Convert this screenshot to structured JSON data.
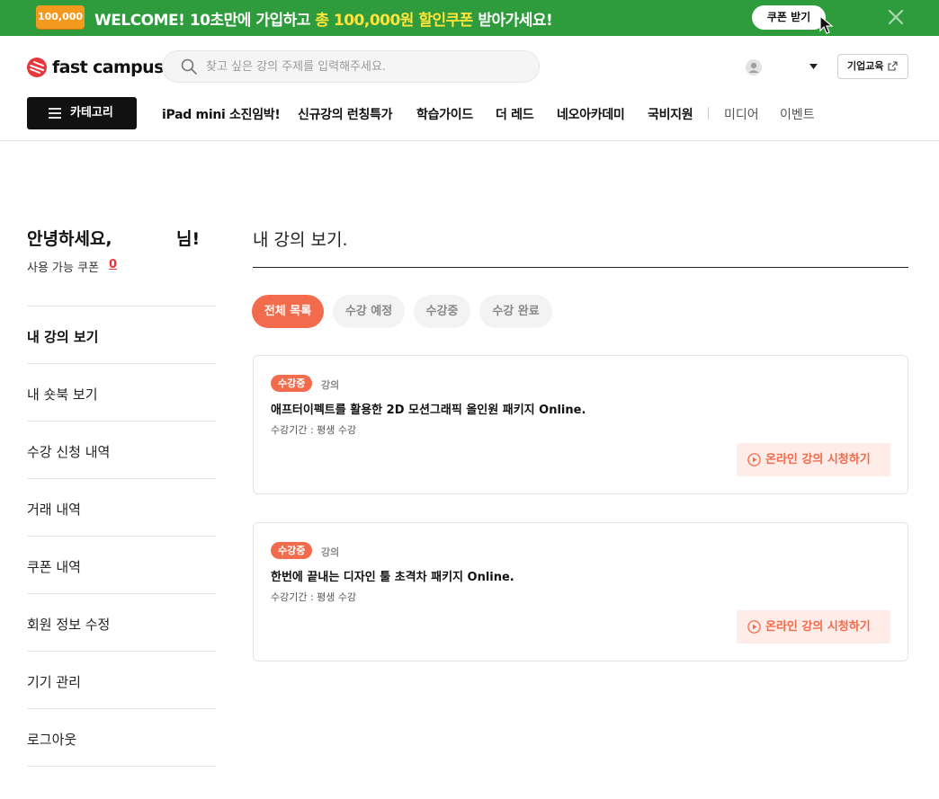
{
  "promo": {
    "badge": "100,000",
    "text_part1": "WELCOME! 10초만에 가입하고 ",
    "text_highlight": "총 100,000원 할인쿠폰",
    "text_part2": " 받아가세요!",
    "button_label": "쿠폰 받기",
    "bg_color": "#2e9c3c",
    "highlight_color": "#ffe33a"
  },
  "header": {
    "logo_text": "fast campus",
    "search_placeholder": "찾고 싶은 강의 주제를 입력해주세요.",
    "corp_button_label": "기업교육"
  },
  "nav": {
    "category_label": "카테고리",
    "items": [
      {
        "label": "iPad mini 소진임박!",
        "style": "bold"
      },
      {
        "label": "신규강의 런칭특가",
        "style": "bold"
      },
      {
        "label": "학습가이드",
        "style": "bold"
      },
      {
        "label": "더 레드",
        "style": "bold"
      },
      {
        "label": "네오아카데미",
        "style": "bold"
      },
      {
        "label": "국비지원",
        "style": "bold"
      },
      {
        "label": "미디어",
        "style": "light"
      },
      {
        "label": "이벤트",
        "style": "light"
      }
    ]
  },
  "sidebar": {
    "greeting": "안녕하세요,",
    "greeting_suffix": "님!",
    "coupon_label": "사용 가능 쿠폰",
    "coupon_count": "0",
    "items": [
      {
        "label": "내 강의 보기",
        "active": true
      },
      {
        "label": "내 숏북 보기",
        "active": false
      },
      {
        "label": "수강 신청 내역",
        "active": false
      },
      {
        "label": "거래 내역",
        "active": false
      },
      {
        "label": "쿠폰 내역",
        "active": false
      },
      {
        "label": "회원 정보 수정",
        "active": false
      },
      {
        "label": "기기 관리",
        "active": false
      },
      {
        "label": "로그아웃",
        "active": false
      }
    ]
  },
  "main": {
    "title": "내 강의 보기.",
    "tabs": [
      {
        "label": "전체 목록",
        "active": true
      },
      {
        "label": "수강 예정",
        "active": false
      },
      {
        "label": "수강중",
        "active": false
      },
      {
        "label": "수강 완료",
        "active": false
      }
    ],
    "courses": [
      {
        "status": "수강중",
        "type": "강의",
        "title": "애프터이펙트를 활용한 2D 모션그래픽 올인원 패키지 Online.",
        "period": "수강기간 : 평생 수강",
        "action_label": "온라인 강의 시청하기"
      },
      {
        "status": "수강중",
        "type": "강의",
        "title": "한번에 끝내는 디자인 툴 초격차 패키지 Online.",
        "period": "수강기간 : 평생 수강",
        "action_label": "온라인 강의 시청하기"
      }
    ],
    "accent_color": "#f26b4c"
  }
}
